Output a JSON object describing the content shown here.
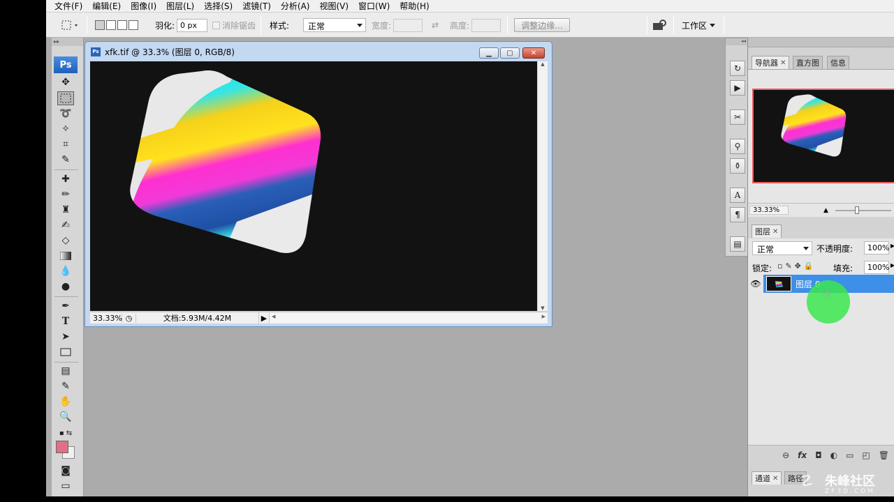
{
  "menu": [
    "文件(F)",
    "编辑(E)",
    "图像(I)",
    "图层(L)",
    "选择(S)",
    "滤镜(T)",
    "分析(A)",
    "视图(V)",
    "窗口(W)",
    "帮助(H)"
  ],
  "options": {
    "feather_label": "羽化:",
    "feather_value": "0 px",
    "antialias_label": "消除锯齿",
    "style_label": "样式:",
    "style_value": "正常",
    "width_label": "宽度:",
    "height_label": "高度:",
    "refine_edge": "调整边缘...",
    "workspace": "工作区"
  },
  "toolbox": {
    "logo": "Ps"
  },
  "document": {
    "title": "xfk.tif @ 33.3% (图层 0, RGB/8)",
    "zoom": "33.33%",
    "doc_info": "文档:5.93M/4.42M"
  },
  "navigator": {
    "tabs": [
      "导航器",
      "直方图",
      "信息"
    ],
    "zoom": "33.33%"
  },
  "layers": {
    "tab": "图层",
    "blend_mode": "正常",
    "opacity_label": "不透明度:",
    "opacity_value": "100%",
    "lock_label": "锁定:",
    "fill_label": "填充:",
    "fill_value": "100%",
    "layer_name": "图层 0",
    "bottom_tabs": [
      "通道",
      "路径"
    ]
  },
  "watermark": {
    "text": "朱峰社区",
    "sub": "ZF3D.COM"
  },
  "colors": {
    "foreground": "#e07088",
    "background": "#f0f0f0",
    "selection": "#3d8fe7",
    "canvas": "#121212"
  }
}
